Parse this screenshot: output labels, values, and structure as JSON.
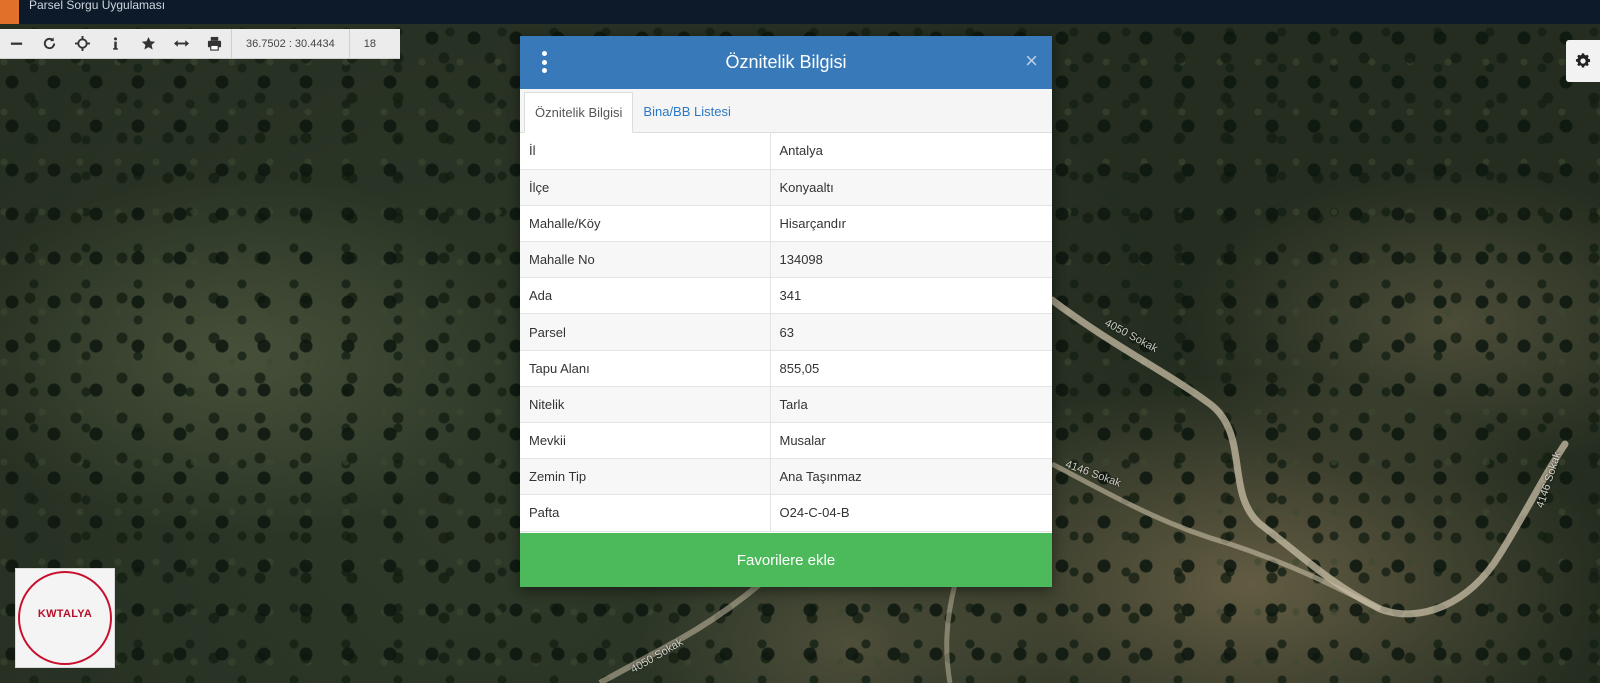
{
  "app": {
    "title": "Parsel Sorgu Uygulaması"
  },
  "toolbar": {
    "tools": [
      {
        "name": "zoom-out-icon"
      },
      {
        "name": "refresh-icon"
      },
      {
        "name": "locate-icon"
      },
      {
        "name": "info-icon"
      },
      {
        "name": "favorite-star-icon"
      },
      {
        "name": "measure-icon"
      },
      {
        "name": "print-icon"
      }
    ],
    "coordinates": "36.7502 : 30.4434",
    "zoom": "18"
  },
  "map": {
    "road_labels": [
      "4050 Sokak",
      "4146 Sokak",
      "4146 Sokak",
      "4050 Sokak"
    ]
  },
  "modal": {
    "title": "Öznitelik Bilgisi",
    "close": "×",
    "tabs": [
      {
        "label": "Öznitelik Bilgisi",
        "active": true
      },
      {
        "label": "Bina/BB Listesi",
        "active": false
      }
    ],
    "rows": [
      {
        "key": "İl",
        "value": "Antalya"
      },
      {
        "key": "İlçe",
        "value": "Konyaaltı"
      },
      {
        "key": "Mahalle/Köy",
        "value": "Hisarçandır"
      },
      {
        "key": "Mahalle No",
        "value": "134098"
      },
      {
        "key": "Ada",
        "value": "341"
      },
      {
        "key": "Parsel",
        "value": "63"
      },
      {
        "key": "Tapu Alanı",
        "value": "855,05"
      },
      {
        "key": "Nitelik",
        "value": "Tarla"
      },
      {
        "key": "Mevkii",
        "value": "Musalar"
      },
      {
        "key": "Zemin Tip",
        "value": "Ana Taşınmaz"
      },
      {
        "key": "Pafta",
        "value": "O24-C-04-B"
      }
    ],
    "favorite_button": "Favorilere ekle"
  },
  "logo": {
    "text": "KWTALYA"
  },
  "colors": {
    "header_blue": "#3779b9",
    "button_green": "#4cb95b",
    "topbar": "#0c1a2a",
    "brand_orange": "#e0702a"
  }
}
